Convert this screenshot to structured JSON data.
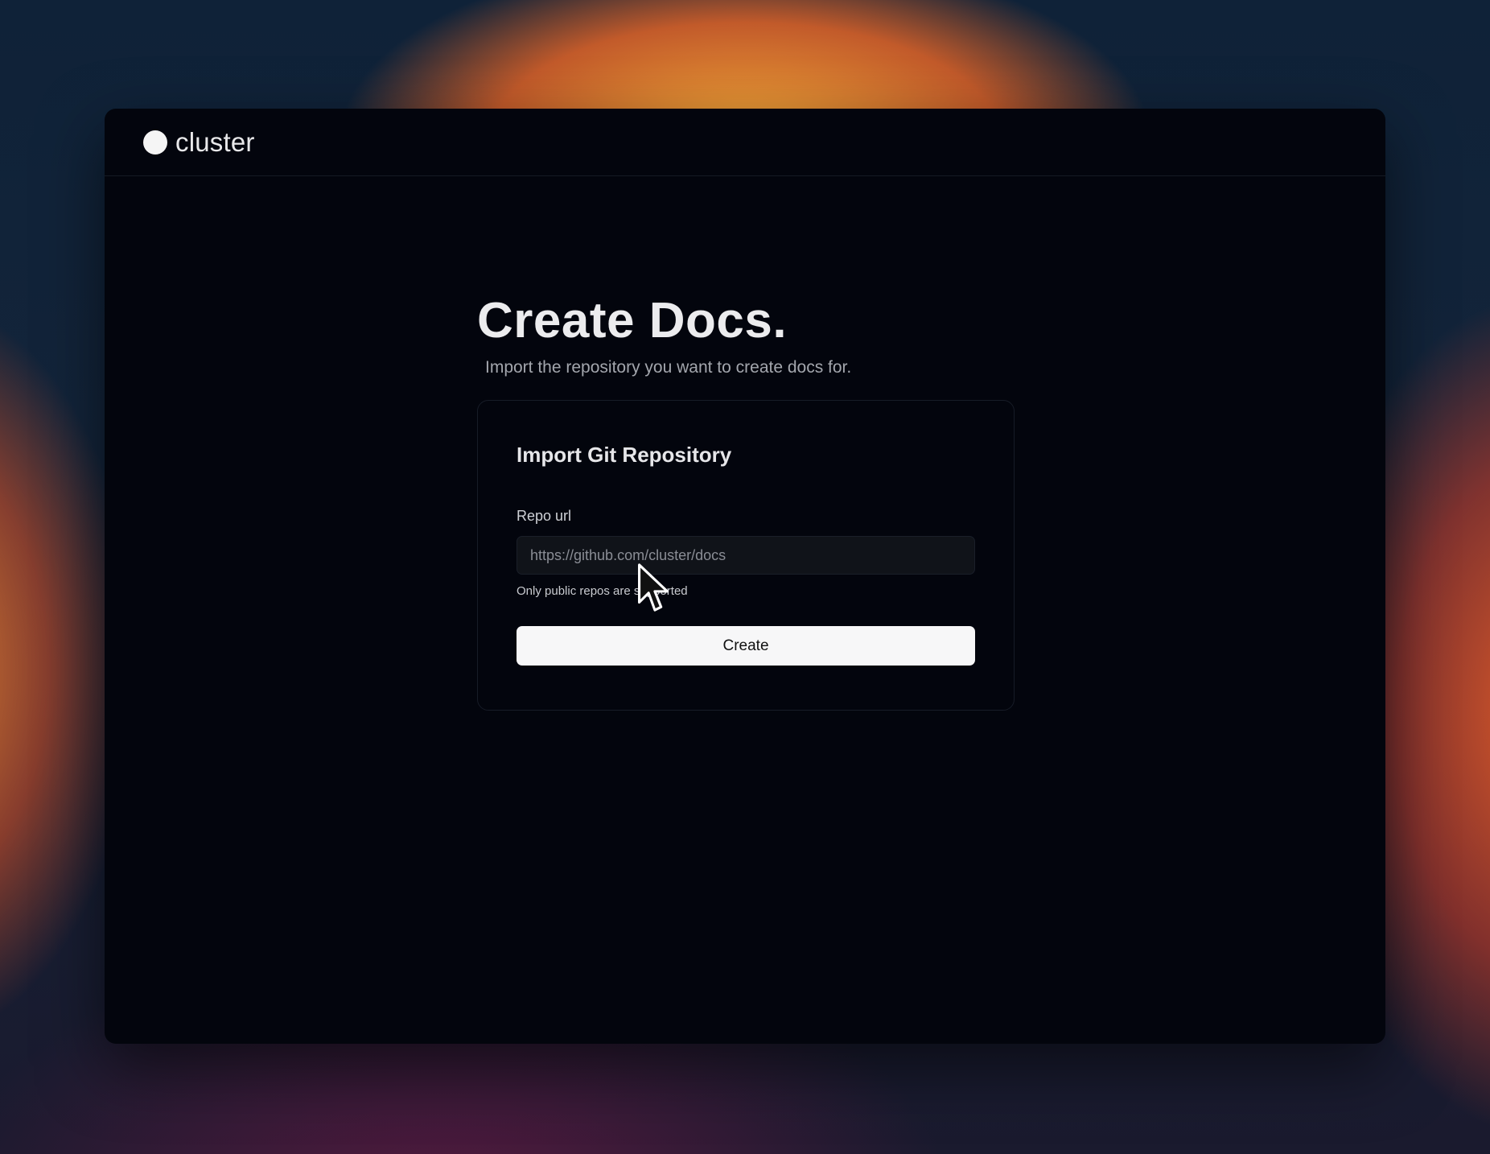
{
  "app": {
    "logo_text": "cluster"
  },
  "page": {
    "title": "Create Docs.",
    "subtitle": "Import the repository you want to create docs for."
  },
  "card": {
    "title": "Import Git Repository",
    "repo_label": "Repo url",
    "repo_placeholder": "https://github.com/cluster/docs",
    "hint": "Only public repos are supported",
    "create_label": "Create"
  },
  "colors": {
    "window_bg": "#03050d",
    "button_bg": "#f7f7f8",
    "input_bg": "#101319"
  },
  "icons": {
    "logo": "logo-dot-icon",
    "cursor": "mouse-pointer-icon"
  }
}
